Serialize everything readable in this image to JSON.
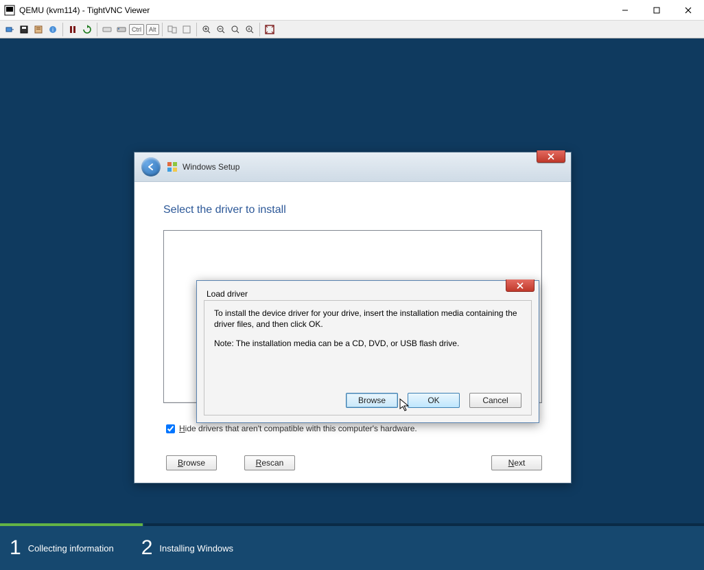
{
  "vnc": {
    "title": "QEMU (kvm114) - TightVNC Viewer",
    "buttons": {
      "min": "—",
      "max": "▢",
      "close": "✕"
    }
  },
  "toolbar": {
    "ctrl": "Ctrl",
    "alt": "Alt"
  },
  "setup": {
    "title": "Windows Setup",
    "heading": "Select the driver to install",
    "hide_label_pre": "H",
    "hide_label_rest": "ide drivers that aren't compatible with this computer's hardware.",
    "browse_un": "B",
    "browse_rest": "rowse",
    "rescan_un": "R",
    "rescan_rest": "escan",
    "next_un": "N",
    "next_rest": "ext"
  },
  "load": {
    "title": "Load driver",
    "para1": "To install the device driver for your drive, insert the installation media containing the driver files, and then click OK.",
    "para2": "Note: The installation media can be a CD, DVD, or USB flash drive.",
    "browse": "Browse",
    "ok": "OK",
    "cancel": "Cancel"
  },
  "footer": {
    "step1_num": "1",
    "step1_label": "Collecting information",
    "step2_num": "2",
    "step2_label": "Installing Windows"
  }
}
